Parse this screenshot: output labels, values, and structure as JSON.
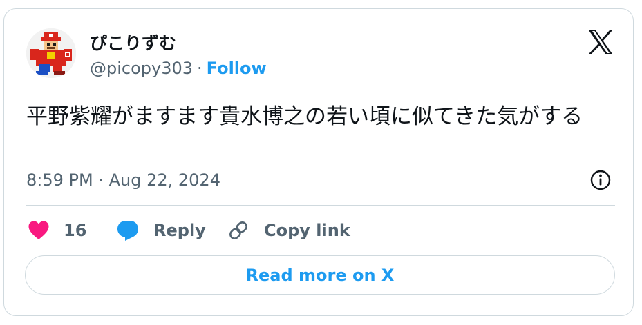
{
  "author": {
    "display_name": "ぴこりずむ",
    "handle": "@picopy303",
    "separator": "·",
    "follow_label": "Follow"
  },
  "tweet": {
    "text": "平野紫耀がますます貴水博之の若い頃に似てきた気がする",
    "timestamp": "8:59 PM · Aug 22, 2024"
  },
  "actions": {
    "like_count": "16",
    "reply_label": "Reply",
    "copy_link_label": "Copy link"
  },
  "read_more_label": "Read more on X",
  "icons": {
    "brand": "x-logo-icon",
    "info": "info-icon",
    "like": "heart-icon",
    "reply": "reply-bubble-icon",
    "copy": "link-icon"
  },
  "colors": {
    "accent": "#1d9bf0",
    "like": "#f91880",
    "muted_text": "#536471",
    "border": "#cfd9de"
  }
}
